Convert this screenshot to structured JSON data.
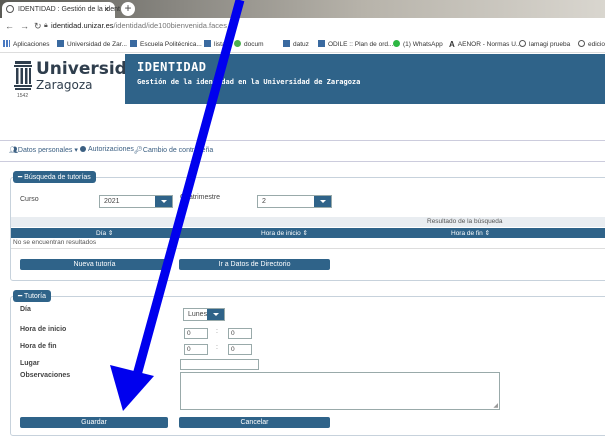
{
  "browser": {
    "tab_title": "IDENTIDAD : Gestión de la ident",
    "tab_close": "×",
    "new_tab": "+",
    "url_host": "identidad.unizar.es",
    "url_path": "/identidad/ide100bienvenida.faces",
    "bookmarks": [
      "Aplicaciones",
      "Universidad de Zar...",
      "Escuela Politécnica...",
      "listas",
      "docum",
      "datuz",
      "ODILE :: Plan de ord...",
      "(1) WhatsApp",
      "AENOR - Normas U...",
      "lamagi prueba",
      "edicio"
    ]
  },
  "header": {
    "logo_name_1": "Universidad",
    "logo_name_2": "Zaragoza",
    "logo_year": "1542",
    "banner_title": "IDENTIDAD",
    "banner_subtitle": "Gestión de la identidad en la Universidad de Zaragoza"
  },
  "menu": {
    "personal": "Datos personales",
    "authorizations": "Autorizaciones",
    "password": "Cambio de contraseña"
  },
  "search": {
    "legend": "Búsqueda de tutorías",
    "course_label": "Curso",
    "course_value": "2021",
    "term_label": "Cuatrimestre",
    "term_value": "2",
    "results_header": "Resultado de la búsqueda",
    "columns": [
      "Día ⇕",
      "Hora de inicio ⇕",
      "Hora de fin ⇕"
    ],
    "empty_message": "No se encuentran resultados",
    "new_button": "Nueva tutoría",
    "directory_button": "Ir a Datos de Directorio"
  },
  "tutoria": {
    "legend": "Tutoría",
    "day_label": "Día",
    "day_value": "Lunes",
    "start_label": "Hora de inicio",
    "end_label": "Hora de fin",
    "start_h": "0",
    "start_m": "0",
    "end_h": "0",
    "end_m": "0",
    "colon": ":",
    "place_label": "Lugar",
    "notes_label": "Observaciones",
    "save_button": "Guardar",
    "cancel_button": "Cancelar"
  },
  "colors": {
    "brand_blue": "#2f6389",
    "annotation_arrow": "#0000ee"
  }
}
